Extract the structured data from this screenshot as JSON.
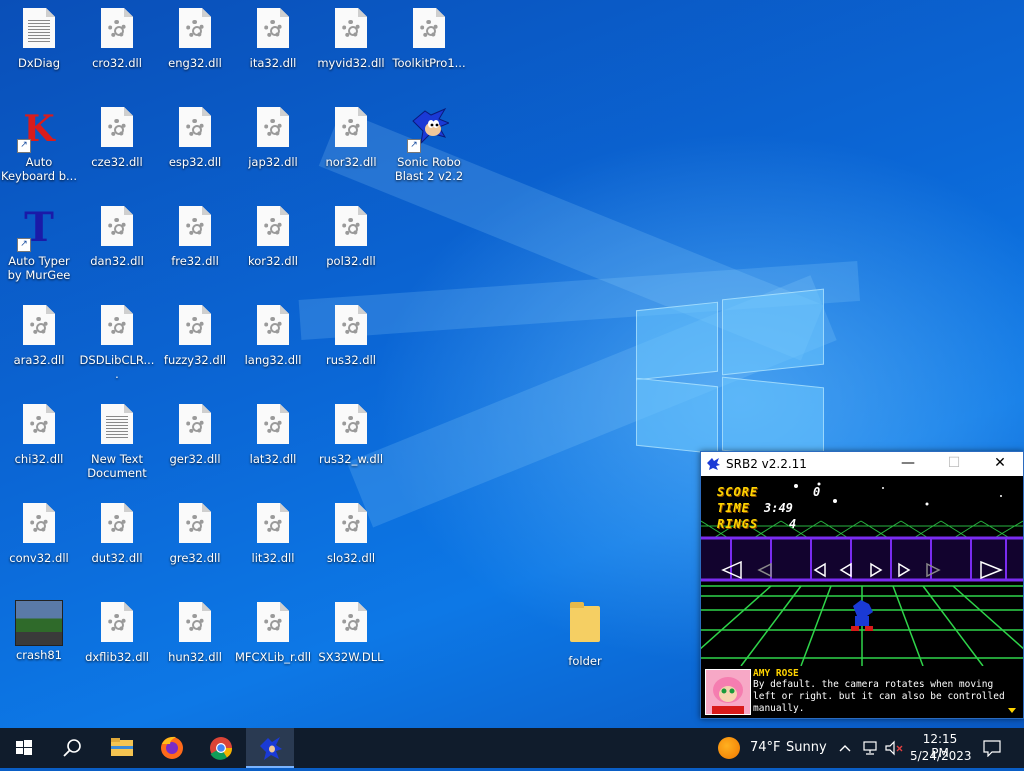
{
  "desktop": {
    "icons": [
      {
        "label": "DxDiag"
      },
      {
        "label": "cro32.dll"
      },
      {
        "label": "eng32.dll"
      },
      {
        "label": "ita32.dll"
      },
      {
        "label": "myvid32.dll"
      },
      {
        "label": "ToolkitPro1..."
      },
      {
        "label": "Auto Keyboard b..."
      },
      {
        "label": "cze32.dll"
      },
      {
        "label": "esp32.dll"
      },
      {
        "label": "jap32.dll"
      },
      {
        "label": "nor32.dll"
      },
      {
        "label": "Sonic Robo Blast 2 v2.2"
      },
      {
        "label": "Auto Typer by MurGee"
      },
      {
        "label": "dan32.dll"
      },
      {
        "label": "fre32.dll"
      },
      {
        "label": "kor32.dll"
      },
      {
        "label": "pol32.dll"
      },
      {
        "label": "ara32.dll"
      },
      {
        "label": "DSDLibCLR...."
      },
      {
        "label": "fuzzy32.dll"
      },
      {
        "label": "lang32.dll"
      },
      {
        "label": "rus32.dll"
      },
      {
        "label": "chi32.dll"
      },
      {
        "label": "New Text Document"
      },
      {
        "label": "ger32.dll"
      },
      {
        "label": "lat32.dll"
      },
      {
        "label": "rus32_w.dll"
      },
      {
        "label": "conv32.dll"
      },
      {
        "label": "dut32.dll"
      },
      {
        "label": "gre32.dll"
      },
      {
        "label": "lit32.dll"
      },
      {
        "label": "slo32.dll"
      },
      {
        "label": "crash81"
      },
      {
        "label": "dxflib32.dll"
      },
      {
        "label": "hun32.dll"
      },
      {
        "label": "MFCXLib_r.dll"
      },
      {
        "label": "SX32W.DLL"
      },
      {
        "label": "folder"
      }
    ],
    "shortcut_glyph": "↗"
  },
  "srb2_window": {
    "title": "SRB2 v2.2.11",
    "minimize_glyph": "—",
    "maximize_glyph": "☐",
    "close_glyph": "✕",
    "hud": {
      "score_label": "SCORE",
      "score_value": "0",
      "time_label": "TIME",
      "time_value": "3:49",
      "rings_label": "RINGS",
      "rings_value": "4"
    },
    "dialog": {
      "speaker": "AMY ROSE",
      "text": "By default. the camera rotates when moving left or right. but it can also be controlled manually."
    }
  },
  "taskbar": {
    "weather_temp": "74°F",
    "weather_desc": "Sunny",
    "clock_time": "12:15 PM",
    "clock_date": "5/24/2023",
    "tray_chevron": "^",
    "notification_glyph": "🗨"
  },
  "colors": {
    "taskbar_bg": "#101c2c",
    "hud_yellow": "#ffd400",
    "grid_green": "#2fd44a",
    "wall_purple": "#6a1fd4"
  }
}
